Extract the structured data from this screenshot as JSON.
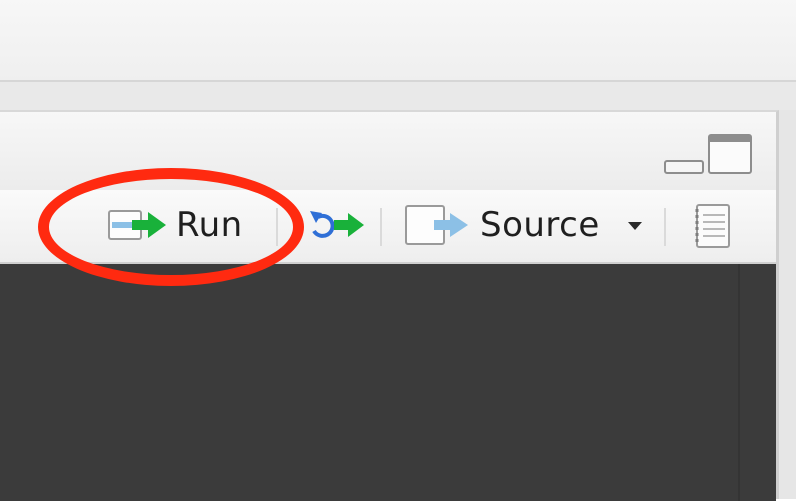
{
  "toolbar": {
    "run_label": "Run",
    "source_label": "Source",
    "icons": {
      "run": "run-line-icon",
      "rerun": "rerun-region-icon",
      "source": "source-file-icon",
      "dropdown": "caret-down-icon",
      "compile": "compile-notebook-icon"
    }
  },
  "annotation": {
    "highlight_color": "#ff2a10",
    "target": "run-button"
  },
  "colors": {
    "arrow_green": "#19b13a",
    "arrow_blue": "#8cc0e6",
    "editor_background": "#3b3b3b"
  }
}
